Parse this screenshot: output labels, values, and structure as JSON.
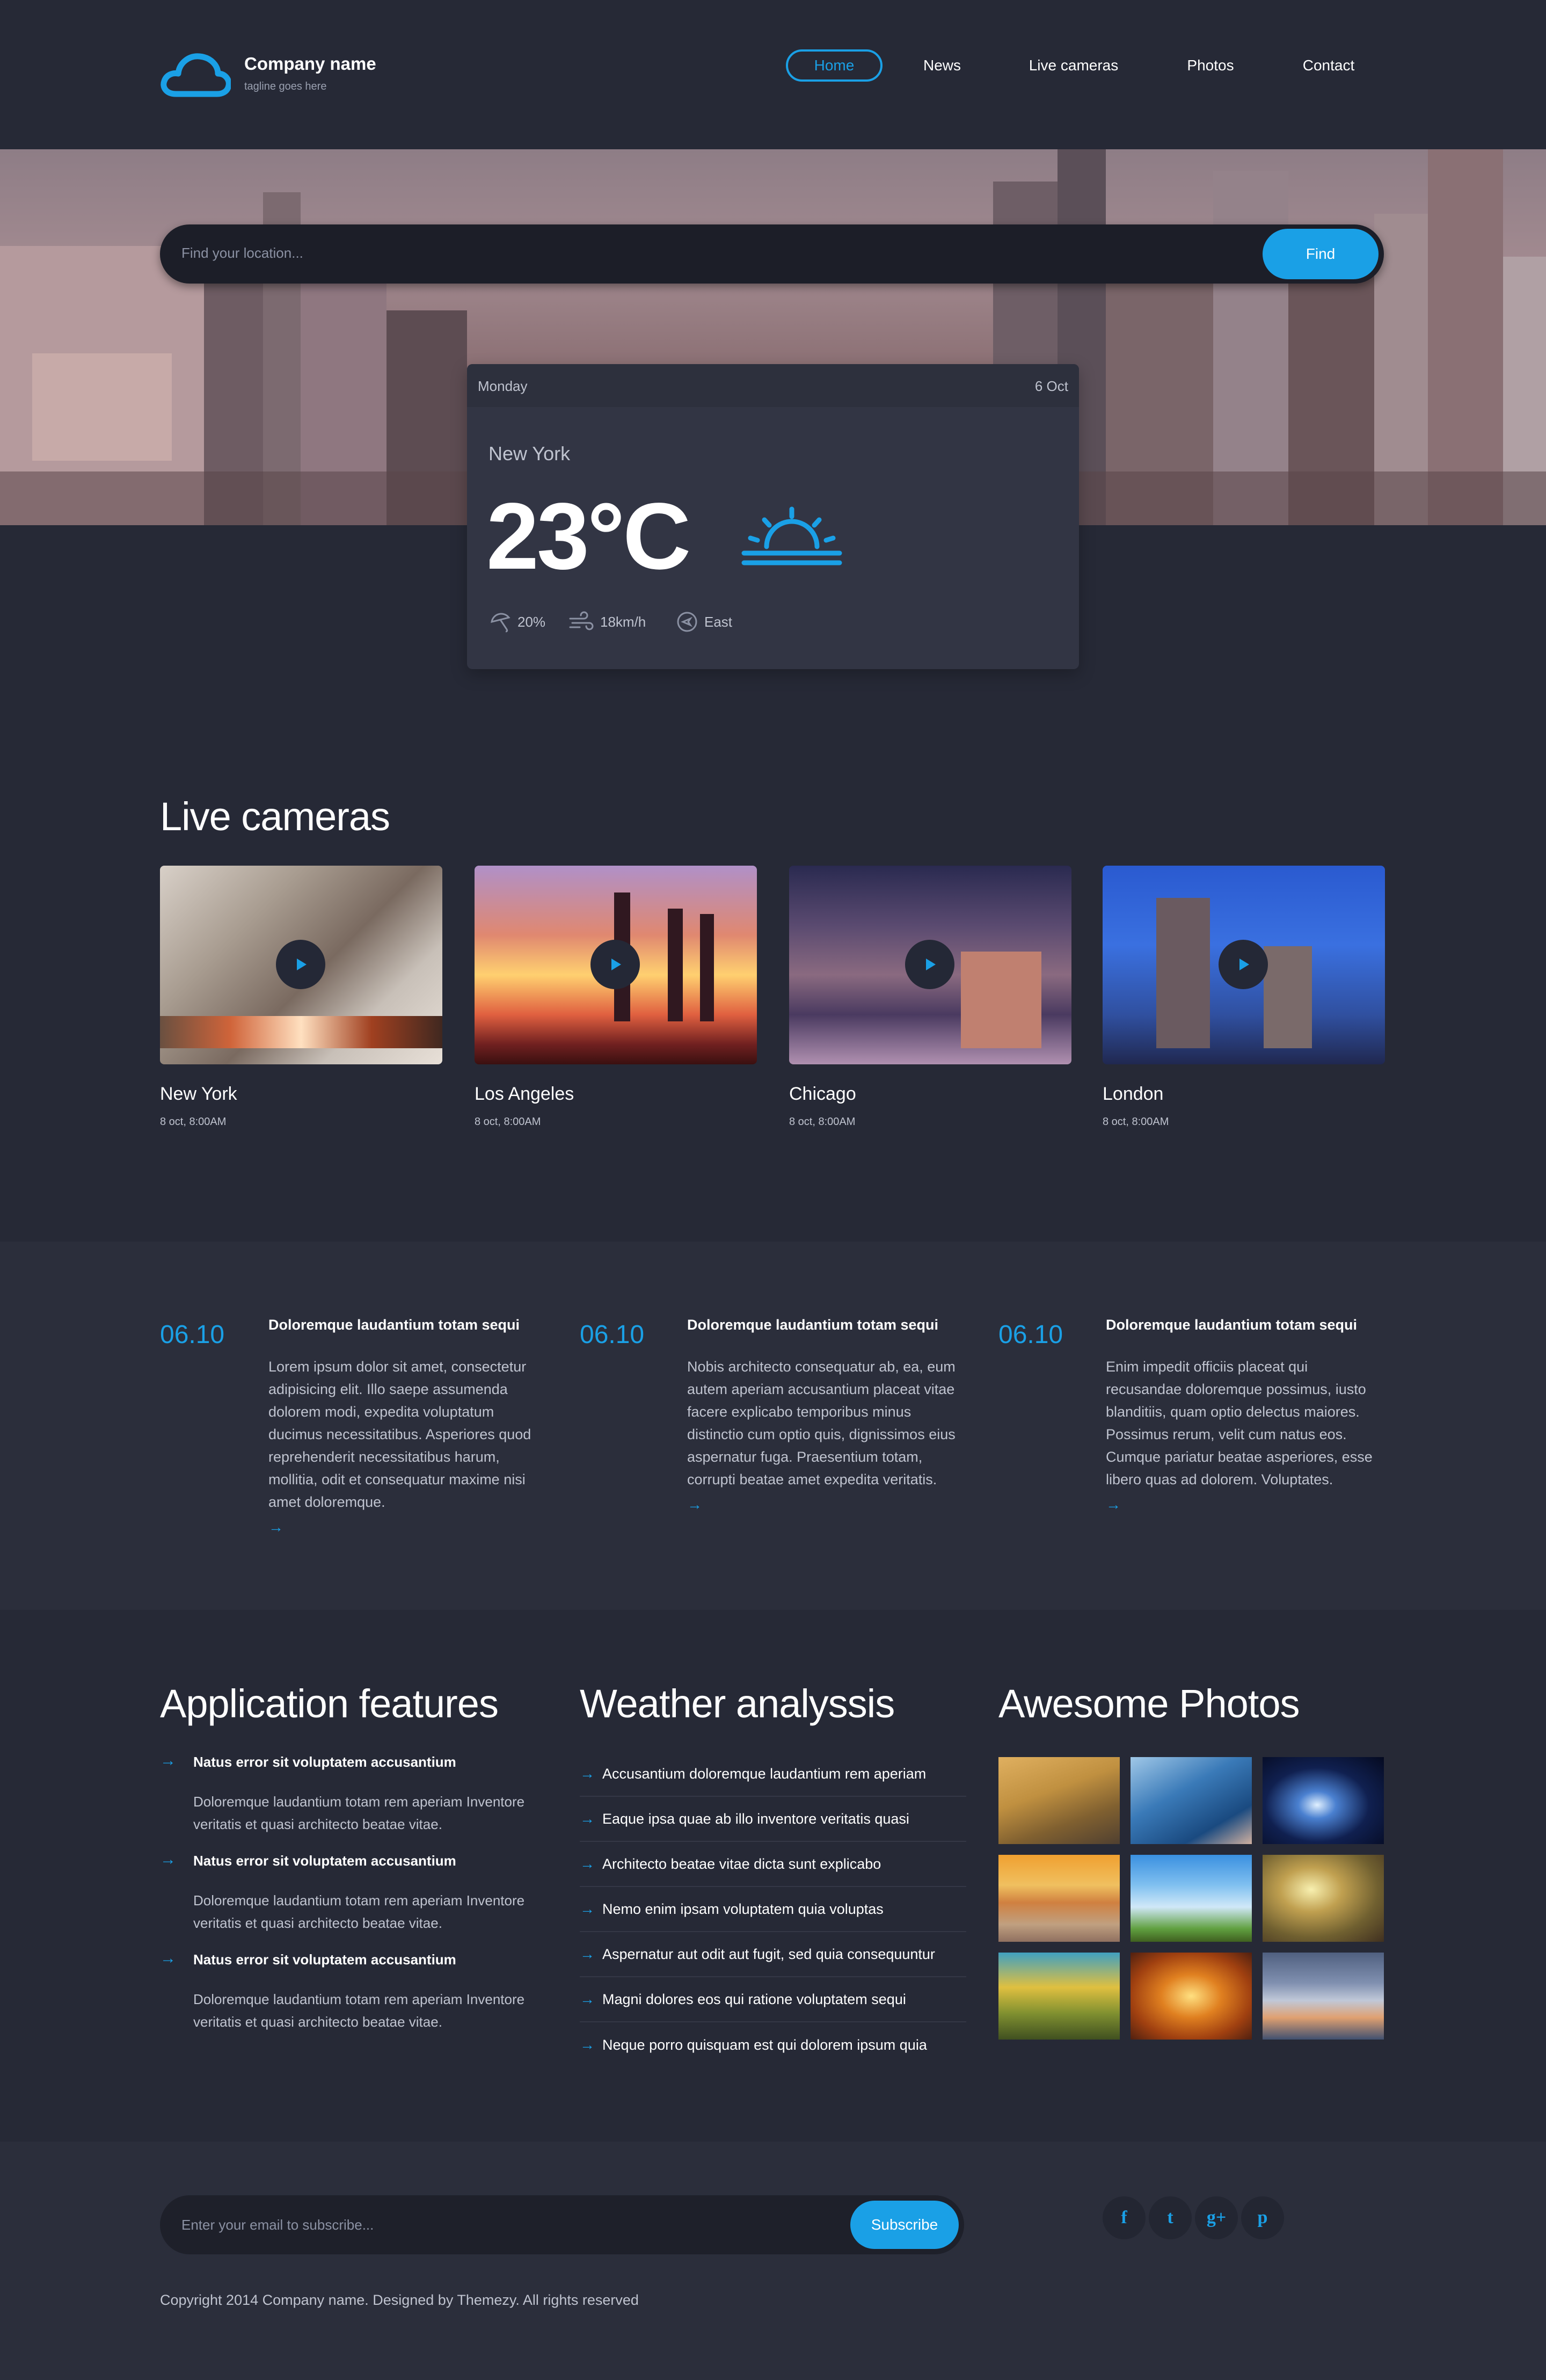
{
  "header": {
    "company_name": "Company name",
    "tagline": "tagline goes here",
    "nav": [
      "Home",
      "News",
      "Live cameras",
      "Photos",
      "Contact"
    ]
  },
  "search": {
    "placeholder": "Find your location...",
    "button": "Find"
  },
  "forecast": {
    "day": "Monday",
    "date": "6 Oct",
    "city": "New York",
    "temp": "23",
    "unit": "°C",
    "rain": "20%",
    "wind": "18km/h",
    "direction": "East",
    "icon": "sun-icon"
  },
  "live_cameras": {
    "title": "Live cameras",
    "items": [
      {
        "city": "New York",
        "time": "8 oct, 8:00AM"
      },
      {
        "city": "Los Angeles",
        "time": "8 oct, 8:00AM"
      },
      {
        "city": "Chicago",
        "time": "8 oct, 8:00AM"
      },
      {
        "city": "London",
        "time": "8 oct, 8:00AM"
      }
    ]
  },
  "news": [
    {
      "date": "06.10",
      "title": "Doloremque laudantium totam sequi",
      "lines": [
        "Lorem ipsum dolor sit amet, consectetur",
        "adipisicing elit. Illo saepe assumenda",
        "dolorem modi, expedita voluptatum",
        "ducimus necessitatibus. Asperiores quod",
        "reprehenderit necessitatibus harum,",
        "mollitia, odit et consequatur maxime nisi",
        "amet doloremque."
      ],
      "arrow": "→"
    },
    {
      "date": "06.10",
      "title": "Doloremque laudantium totam sequi",
      "lines": [
        "Nobis architecto consequatur ab, ea, eum",
        "autem aperiam accusantium placeat vitae",
        "facere explicabo temporibus minus",
        "distinctio cum optio quis, dignissimos eius",
        "aspernatur fuga. Praesentium totam,",
        "corrupti beatae amet expedita veritatis."
      ],
      "arrow": "→"
    },
    {
      "date": "06.10",
      "title": "Doloremque laudantium totam sequi",
      "lines": [
        "Enim impedit officiis placeat qui",
        "recusandae doloremque possimus, iusto",
        "blanditiis, quam optio delectus maiores.",
        "Possimus rerum, velit cum natus eos.",
        "Cumque pariatur beatae asperiores, esse",
        "libero quas ad dolorem. Voluptates."
      ],
      "arrow": "→"
    }
  ],
  "features": {
    "title": "Application features",
    "items": [
      {
        "title": "Natus error sit voluptatem accusantium",
        "line1": "Doloremque laudantium totam rem aperiam Inventore",
        "line2": "veritatis et quasi architecto beatae vitae."
      },
      {
        "title": "Natus error sit voluptatem accusantium",
        "line1": "Doloremque laudantium totam rem aperiam Inventore",
        "line2": "veritatis et quasi architecto beatae vitae."
      },
      {
        "title": "Natus error sit voluptatem accusantium",
        "line1": "Doloremque laudantium totam rem aperiam Inventore",
        "line2": "veritatis et quasi architecto beatae vitae."
      }
    ]
  },
  "analysis": {
    "title": "Weather analyssis",
    "items": [
      "Accusantium doloremque laudantium rem aperiam",
      "Eaque ipsa quae ab illo inventore veritatis quasi",
      "Architecto beatae vitae dicta sunt explicabo",
      "Nemo enim ipsam voluptatem quia voluptas",
      "Aspernatur aut odit aut fugit, sed quia consequuntur",
      "Magni dolores eos qui ratione voluptatem sequi",
      "Neque porro quisquam est qui dolorem ipsum quia"
    ]
  },
  "photos": {
    "title": "Awesome Photos"
  },
  "footer": {
    "subscribe_placeholder": "Enter your email to subscribe...",
    "subscribe_button": "Subscribe",
    "social": [
      {
        "label": "f",
        "icon": "facebook-icon"
      },
      {
        "label": "t",
        "icon": "twitter-icon"
      },
      {
        "label": "g+",
        "icon": "google-plus-icon"
      },
      {
        "label": "p",
        "icon": "pinterest-icon"
      }
    ],
    "copyright": "Copyright 2014 Company name. Designed by Themezy. All rights reserved"
  },
  "colors": {
    "accent": "#1aa0e6",
    "background": "#262936",
    "panel": "#323544"
  }
}
